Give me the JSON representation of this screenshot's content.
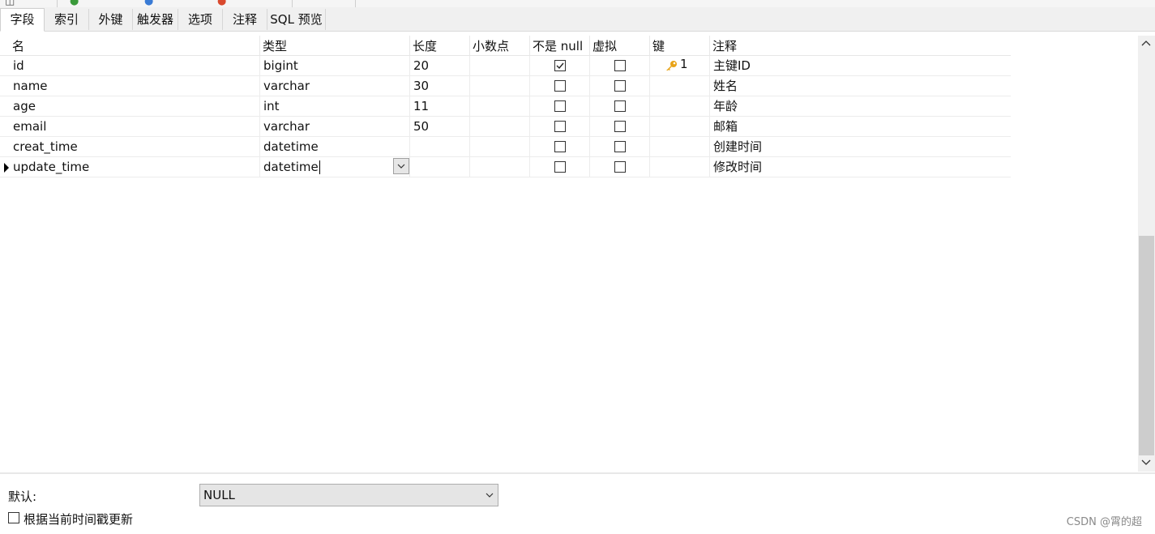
{
  "tabs": [
    "字段",
    "索引",
    "外键",
    "触发器",
    "选项",
    "注释",
    "SQL 预览"
  ],
  "active_tab": "字段",
  "columns": [
    "名",
    "类型",
    "长度",
    "小数点",
    "不是 null",
    "虚拟",
    "键",
    "注释"
  ],
  "rows": [
    {
      "name": "id",
      "type": "bigint",
      "length": "20",
      "decimals": "",
      "not_null": true,
      "virtual": false,
      "key": "1",
      "comment": "主键ID"
    },
    {
      "name": "name",
      "type": "varchar",
      "length": "30",
      "decimals": "",
      "not_null": false,
      "virtual": false,
      "key": "",
      "comment": "姓名"
    },
    {
      "name": "age",
      "type": "int",
      "length": "11",
      "decimals": "",
      "not_null": false,
      "virtual": false,
      "key": "",
      "comment": "年龄"
    },
    {
      "name": "email",
      "type": "varchar",
      "length": "50",
      "decimals": "",
      "not_null": false,
      "virtual": false,
      "key": "",
      "comment": "邮箱"
    },
    {
      "name": "creat_time",
      "type": "datetime",
      "length": "",
      "decimals": "",
      "not_null": false,
      "virtual": false,
      "key": "",
      "comment": "创建时间"
    },
    {
      "name": "update_time",
      "type": "datetime",
      "length": "",
      "decimals": "",
      "not_null": false,
      "virtual": false,
      "key": "",
      "comment": "修改时间"
    }
  ],
  "selected_row": 5,
  "default_label": "默认:",
  "default_value": "NULL",
  "update_checkbox_label": "根据当前时间戳更新",
  "update_checkbox_checked": false,
  "watermark": "CSDN @霄的超",
  "icons": {
    "key": "key-icon",
    "row_marker": "triangle-right-icon",
    "dropdown": "chevron-down-icon"
  },
  "colors": {
    "key_icon": "#e8a317",
    "tab_bar": "#f0f0f0",
    "scroll_thumb": "#cdcdcd"
  }
}
